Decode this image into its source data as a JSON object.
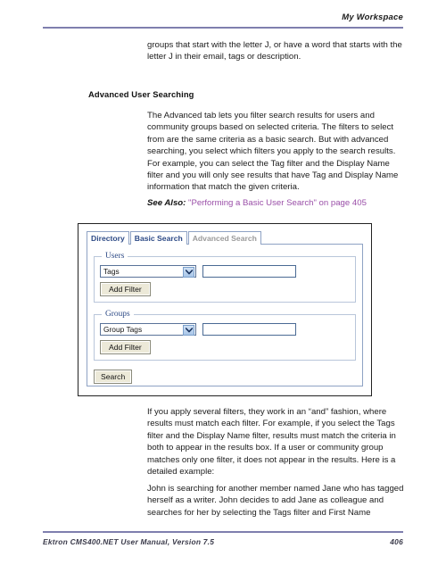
{
  "header": {
    "title": "My Workspace"
  },
  "content": {
    "intro_paragraph": "groups that start with the letter J, or have a word that starts with the letter J in their email, tags or description.",
    "section_heading": "Advanced User Searching",
    "paragraph_1": "The Advanced tab lets you filter search results for users and community groups based on selected criteria. The filters to select from are the same criteria as a basic search. But with advanced searching, you select which filters you apply to the search results. For example, you can select the Tag filter and the Display Name filter and you will only see results that have Tag and Display Name information that match the given criteria.",
    "see_also_label": "See Also:",
    "see_also_link": "\"Performing a Basic User Search\" on page 405",
    "paragraph_2": "If you apply several filters, they work in an “and” fashion, where results must match each filter. For example, if you select the Tags filter and the Display Name filter, results must match the criteria in both to appear in the results box. If a user or community group matches only one filter, it does not appear in the results. Here is a detailed example:",
    "paragraph_3": "John is searching for another member named Jane who has tagged herself as a writer. John decides to add Jane as colleague and searches for her by selecting the Tags filter and First Name"
  },
  "screenshot": {
    "tabs": [
      {
        "label": "Directory",
        "active": false
      },
      {
        "label": "Basic Search",
        "active": false
      },
      {
        "label": "Advanced Search",
        "active": true
      }
    ],
    "users_group": {
      "legend": "Users",
      "filter_select_value": "Tags",
      "filter_input_value": "",
      "filter_input_placeholder": "",
      "add_filter_label": "Add Filter",
      "dropdown_icon": "chevron-down-icon"
    },
    "groups_group": {
      "legend": "Groups",
      "filter_select_value": "Group Tags",
      "filter_input_value": "",
      "filter_input_placeholder": "",
      "add_filter_label": "Add Filter",
      "dropdown_icon": "chevron-down-icon"
    },
    "search_button_label": "Search"
  },
  "footer": {
    "manual_title": "Ektron CMS400.NET User Manual, Version 7.5",
    "page_number": "406"
  },
  "colors": {
    "rule_purple": "#7f7fae",
    "link_purple": "#9a4fa8",
    "tab_blue": "#2d4a86",
    "tab_inactive_gray": "#9a9a9a",
    "panel_border": "#8ea2c4",
    "button_face": "#ece9d8"
  }
}
